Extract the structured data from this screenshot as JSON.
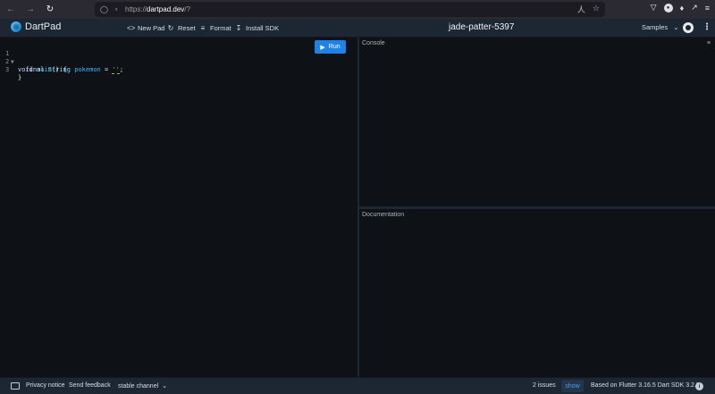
{
  "browser": {
    "url_prefix": "https://",
    "url_domain": "dartpad.dev",
    "url_suffix": "/?",
    "back_icon": "arrow-left-icon",
    "forward_icon": "arrow-right-icon",
    "reload_icon": "reload-icon"
  },
  "header": {
    "logo_text": "DartPad",
    "new_pad_label": "New Pad",
    "reset_label": "Reset",
    "format_label": "Format",
    "install_sdk_label": "Install SDK",
    "pad_title": "jade-patter-5397",
    "samples_label": "Samples"
  },
  "editor": {
    "run_label": "Run",
    "lines": [
      {
        "num": "1",
        "fold": "▼"
      },
      {
        "num": "2",
        "fold": ""
      },
      {
        "num": "3",
        "fold": ""
      }
    ],
    "code": {
      "line1_kw": "void",
      "line1_fn": "main",
      "line1_rest": "() {",
      "line2_kw": "final",
      "line2_type": "String",
      "line2_var": "pokemon",
      "line2_op": " = ",
      "line2_str": "''",
      "line2_end": ";",
      "line3": "}"
    }
  },
  "panes": {
    "console_label": "Console",
    "documentation_label": "Documentation"
  },
  "footer": {
    "privacy_label": "Privacy notice",
    "feedback_label": "Send feedback",
    "channel_label": "stable channel",
    "issues_label": "2 issues",
    "show_label": "show",
    "version_label": "Based on Flutter 3.16.5 Dart SDK 3.2.3"
  },
  "colors": {
    "accent": "#1f82e6",
    "header_bg": "#1d2733",
    "editor_bg": "#0e1116"
  }
}
